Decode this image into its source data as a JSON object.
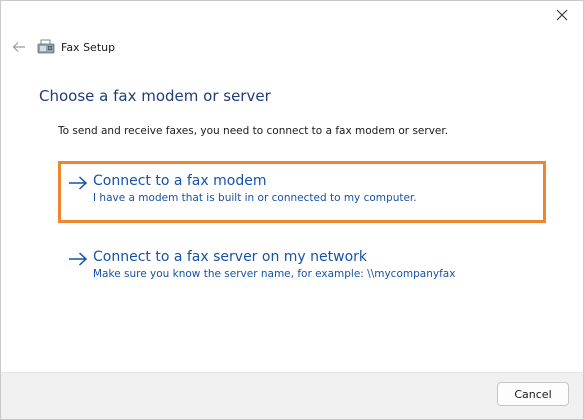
{
  "window": {
    "close_icon": "close-icon",
    "back_icon": "back-arrow-icon",
    "app_icon": "fax-machine-icon",
    "title": "Fax Setup"
  },
  "main": {
    "heading": "Choose a fax modem or server",
    "intro": "To send and receive faxes, you need to connect to a fax modem or server.",
    "options": [
      {
        "title": "Connect to a fax modem",
        "description": "I have a modem that is built in or connected to my computer.",
        "highlighted": true
      },
      {
        "title": "Connect to a fax server on my network",
        "description": "Make sure you know the server name, for example: \\\\mycompanyfax",
        "highlighted": false
      }
    ]
  },
  "footer": {
    "cancel_label": "Cancel"
  },
  "colors": {
    "heading": "#1f3d7a",
    "link": "#1552a8",
    "highlight_border": "#f0852d",
    "footer_bg": "#f0f0f0"
  }
}
